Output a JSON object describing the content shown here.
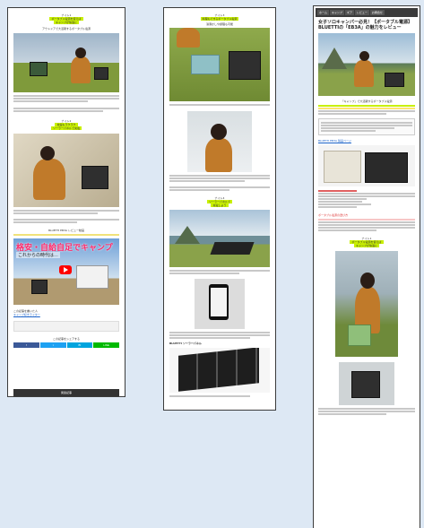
{
  "left": {
    "section1": {
      "num": "ナイト1",
      "hl1": "ポータブル電源を使えば",
      "hl2": "キャンプが快適に",
      "caption": "アウトドアで大活躍するポータブル電源"
    },
    "section2": {
      "num": "ナイト2",
      "hl1": "充電もラクラク",
      "hl2": "ソーラーパネルで充電"
    },
    "video_heading": "BLUETTI EB3A レビュー動画",
    "video_title": "格安・自給自足でキャンプ",
    "video_sub": "これからの時代は…",
    "related_title": "この記事を書いた人",
    "related_link": "キャンプ好きライター",
    "share_label": "この記事をシェアする",
    "share": [
      "f",
      "t",
      "B!",
      "LINE"
    ],
    "footer": "関連記事"
  },
  "middle": {
    "num": "ナイト3",
    "hl1": "料理もできるポータブル電源",
    "caption1": "湯沸かしや調理も可能",
    "num2": "ナイト4",
    "hl2": "ソーラーパネルで",
    "hl3": "充電しよう",
    "sub": "BLUETTI ソーラーパネル"
  },
  "right": {
    "nav": [
      "ホーム",
      "キャンプ",
      "ギア",
      "レビュー",
      "お問合せ"
    ],
    "title": "女子ソロキャンパー必見！【ポータブル電源】BLUETTIの「EB3A」の魅力をレビュー",
    "section": "「キャンプ」で大活躍するポータブル電源",
    "product_link": "BLUETTI EB3A 製品ページ",
    "alert": "ポータブル電源の選び方",
    "num": "ナイト1",
    "hl": "ポータブル電源を使えば",
    "hl_sub": "キャンプが快適に"
  },
  "colors": {
    "highlight": "#c9f000",
    "facebook": "#3b5998",
    "twitter": "#1da1f2",
    "hatena": "#00a4de",
    "line": "#00b900",
    "footer": "#333333"
  }
}
